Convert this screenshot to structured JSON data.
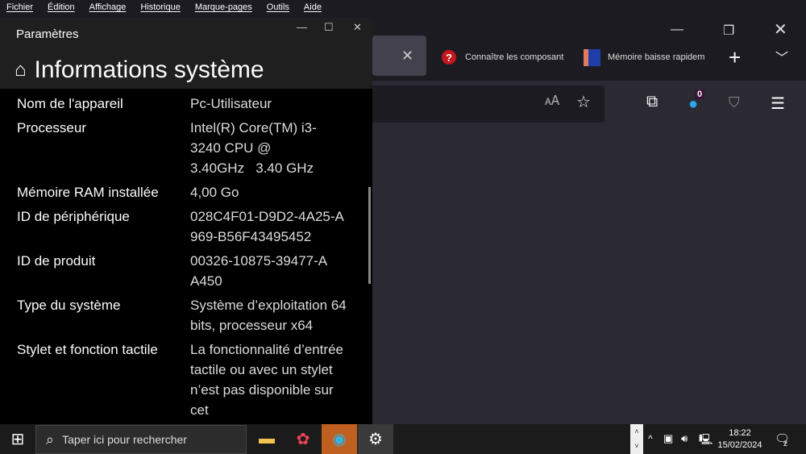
{
  "menu": [
    "Fichier",
    "Édition",
    "Affichage",
    "Historique",
    "Marque-pages",
    "Outils",
    "Aide"
  ],
  "tabs": [
    {
      "label": "Connaître les composant"
    },
    {
      "label": "Mémoire baisse rapidem"
    }
  ],
  "toolbar": {
    "badge": "0"
  },
  "settings": {
    "window_title": "Paramètres",
    "page_title": "Informations système",
    "rows": [
      {
        "key": "Nom de l'appareil",
        "value": "Pc-Utilisateur"
      },
      {
        "key": "Processeur",
        "value": "Intel(R) Core(TM) i3-3240 CPU @ 3.40GHz   3.40 GHz"
      },
      {
        "key": "Mémoire RAM installée",
        "value": "4,00 Go"
      },
      {
        "key": "ID de périphérique",
        "value": "028C4F01-D9D2-4A25-A969-B56F43495452"
      },
      {
        "key": "ID de produit",
        "value": "00326-10875-39477-AA450"
      },
      {
        "key": "Type du système",
        "value": "Système d’exploitation 64 bits, processeur x64"
      },
      {
        "key": "Stylet et fonction tactile",
        "value": "La fonctionnalité d’entrée tactile ou avec un stylet n’est pas disponible sur cet"
      }
    ]
  },
  "taskbar": {
    "search_placeholder": "Taper ici pour rechercher",
    "time": "18:22",
    "date": "15/02/2024",
    "notif_count": "2"
  }
}
